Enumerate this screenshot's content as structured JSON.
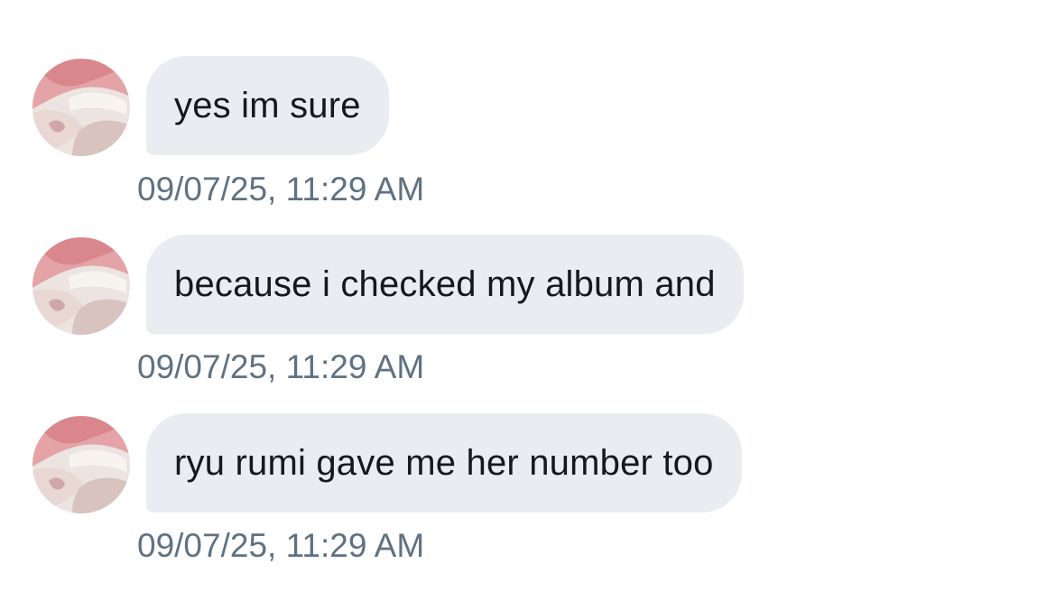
{
  "messages": [
    {
      "avatar_icon": "profile-photo-pink-hair",
      "text": "yes im sure",
      "timestamp": "09/07/25, 11:29 AM"
    },
    {
      "avatar_icon": "profile-photo-pink-hair",
      "text": "because i checked my album and",
      "timestamp": "09/07/25, 11:29 AM"
    },
    {
      "avatar_icon": "profile-photo-pink-hair",
      "text": "ryu rumi gave me her number too",
      "timestamp": "09/07/25, 11:29 AM"
    }
  ],
  "colors": {
    "background": "#ffffff",
    "bubble": "#e9edf2",
    "message_text": "#16181c",
    "timestamp": "#5f7282"
  }
}
